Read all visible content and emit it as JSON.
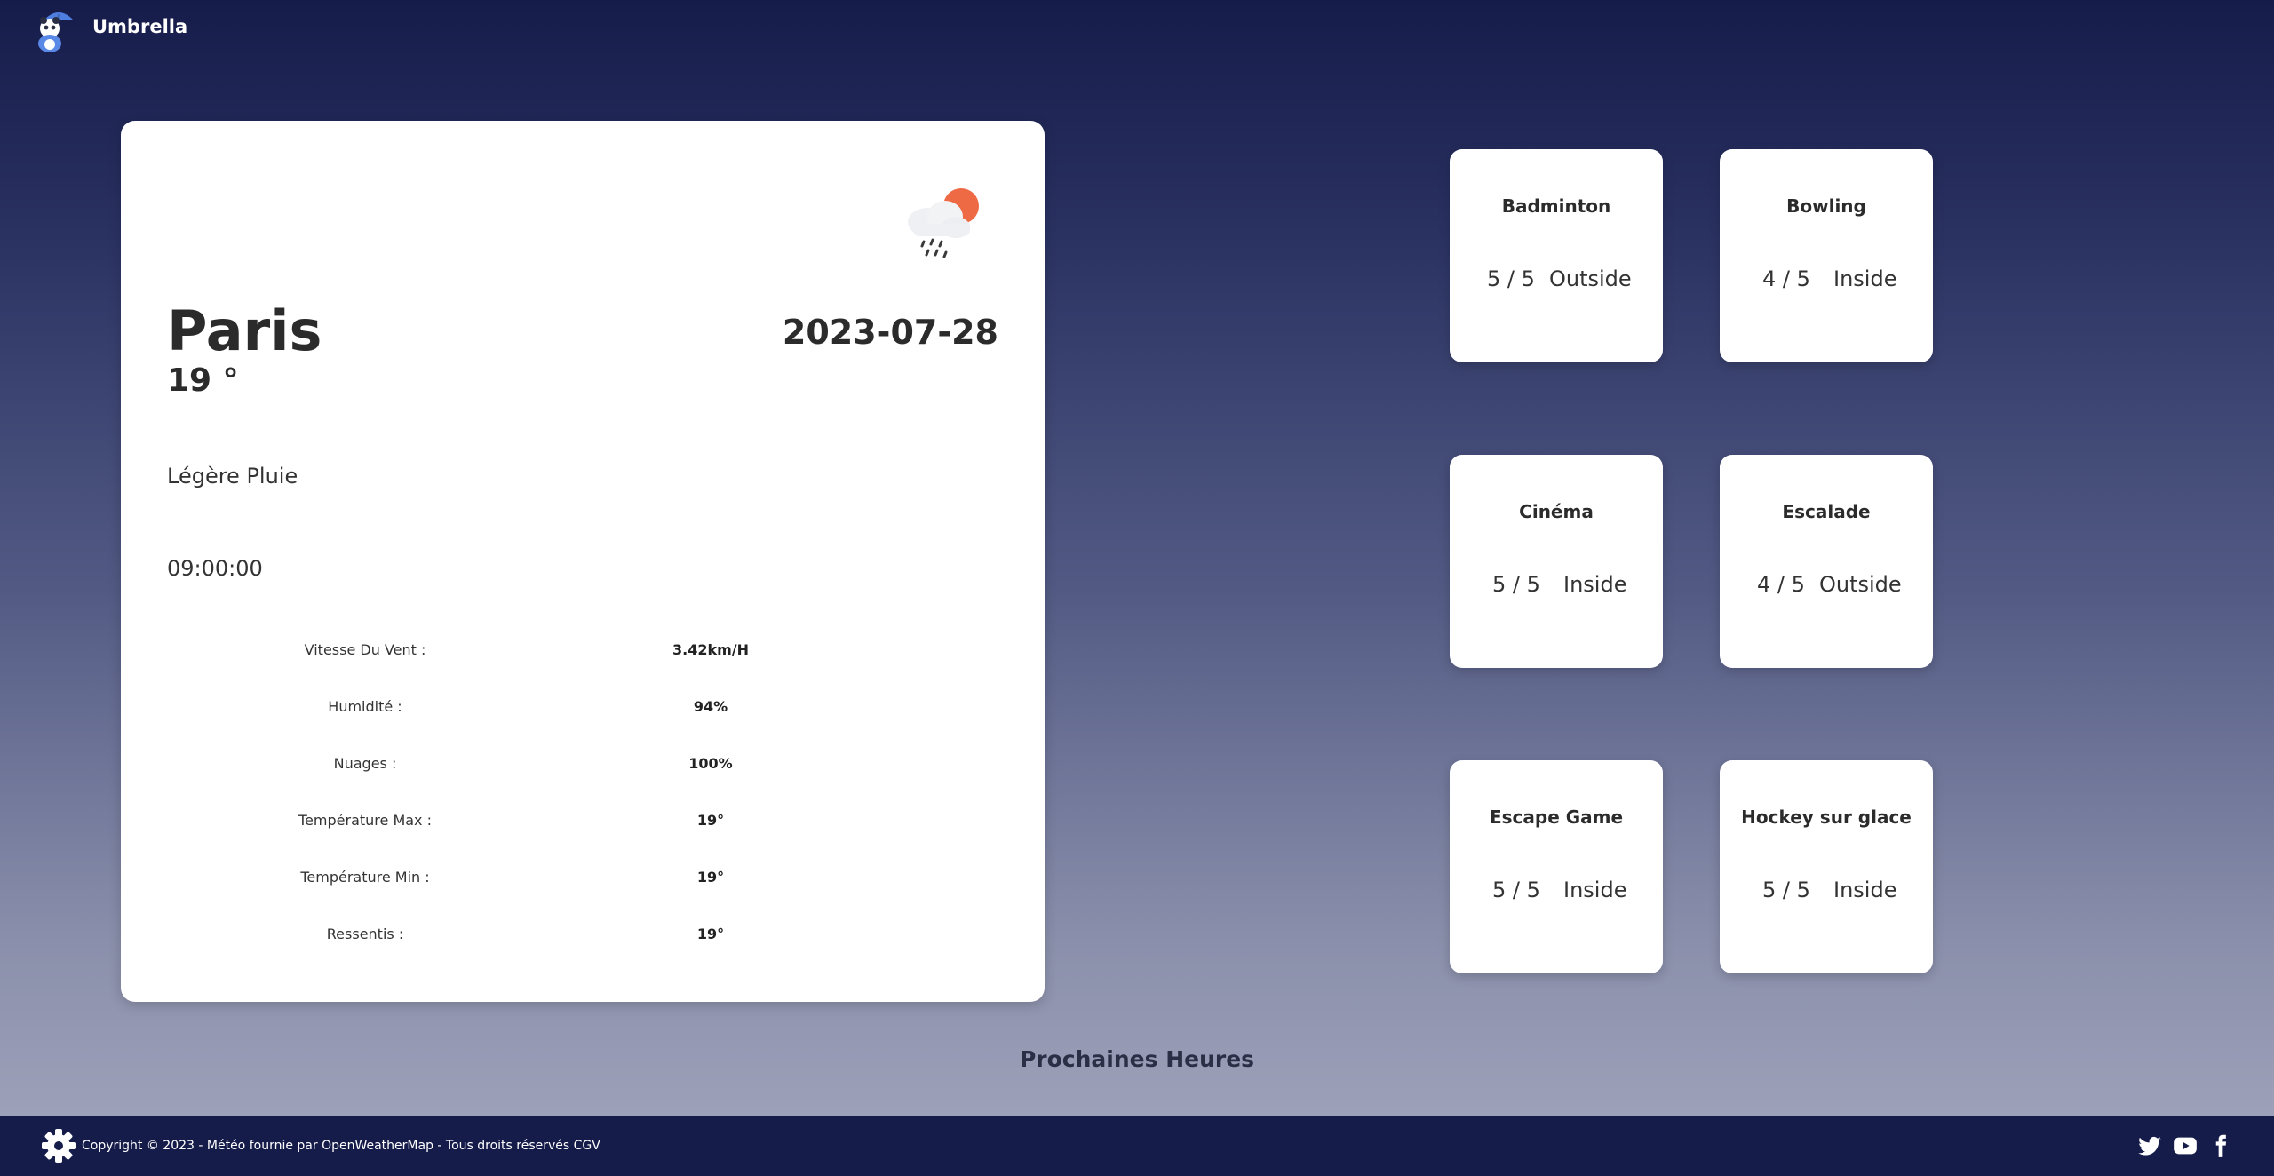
{
  "header": {
    "brand": "Umbrella"
  },
  "weather": {
    "city": "Paris",
    "temperature": "19 °",
    "date": "2023-07-28",
    "description": "Légère Pluie",
    "time": "09:00:00",
    "icon": "rain-sun-icon",
    "stats": [
      {
        "label": "Vitesse Du Vent :",
        "value": "3.42km/H"
      },
      {
        "label": "Humidité :",
        "value": "94%"
      },
      {
        "label": "Nuages :",
        "value": "100%"
      },
      {
        "label": "Température Max :",
        "value": "19°"
      },
      {
        "label": "Température Min :",
        "value": "19°"
      },
      {
        "label": "Ressentis :",
        "value": "19°"
      }
    ]
  },
  "activities": [
    {
      "name": "Badminton",
      "score": "5 / 5",
      "place": "Outside"
    },
    {
      "name": "Bowling",
      "score": "4 / 5",
      "place": "Inside"
    },
    {
      "name": "Cinéma",
      "score": "5 / 5",
      "place": "Inside"
    },
    {
      "name": "Escalade",
      "score": "4 / 5",
      "place": "Outside"
    },
    {
      "name": "Escape Game",
      "score": "5 / 5",
      "place": "Inside"
    },
    {
      "name": "Hockey sur glace",
      "score": "5 / 5",
      "place": "Inside"
    }
  ],
  "next_hours": {
    "title": "Prochaines Heures"
  },
  "footer": {
    "copyright": "Copyright © 2023 - Météo fournie par OpenWeatherMap - Tous droits réservés CGV",
    "social": [
      "twitter-icon",
      "youtube-icon",
      "facebook-icon"
    ]
  },
  "colors": {
    "header_bg": "#161c4a",
    "footer_bg": "#161c4a",
    "sun": "#ee6a45",
    "card_bg": "#ffffff"
  }
}
